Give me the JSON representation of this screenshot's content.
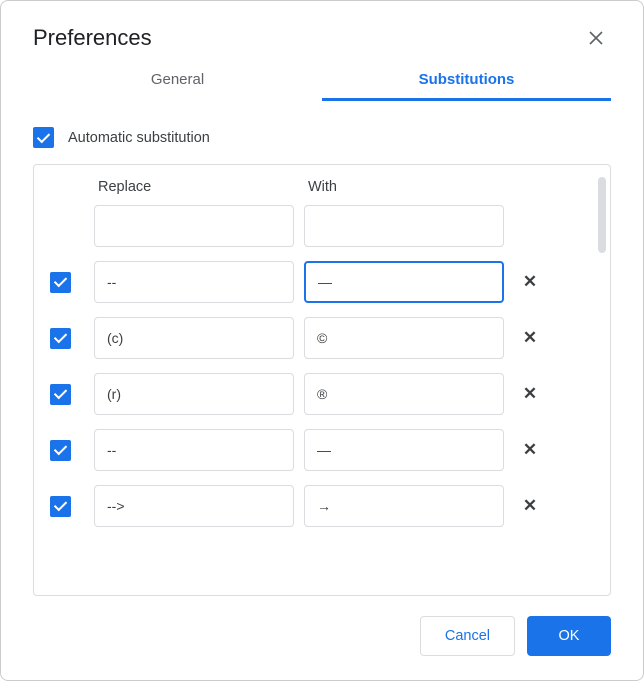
{
  "dialog": {
    "title": "Preferences"
  },
  "tabs": {
    "general": "General",
    "substitutions": "Substitutions"
  },
  "autosub": {
    "label": "Automatic substitution",
    "checked": true
  },
  "columns": {
    "replace": "Replace",
    "with": "With"
  },
  "new_row": {
    "replace": "",
    "with": ""
  },
  "rows": [
    {
      "checked": true,
      "replace": "--",
      "with": "—",
      "with_focused": true
    },
    {
      "checked": true,
      "replace": "(c)",
      "with": "©",
      "with_focused": false
    },
    {
      "checked": true,
      "replace": "(r)",
      "with": "®",
      "with_focused": false
    },
    {
      "checked": true,
      "replace": "--",
      "with": "—",
      "with_focused": false
    },
    {
      "checked": true,
      "replace": "-->",
      "with": "→",
      "with_focused": false
    }
  ],
  "buttons": {
    "cancel": "Cancel",
    "ok": "OK"
  }
}
